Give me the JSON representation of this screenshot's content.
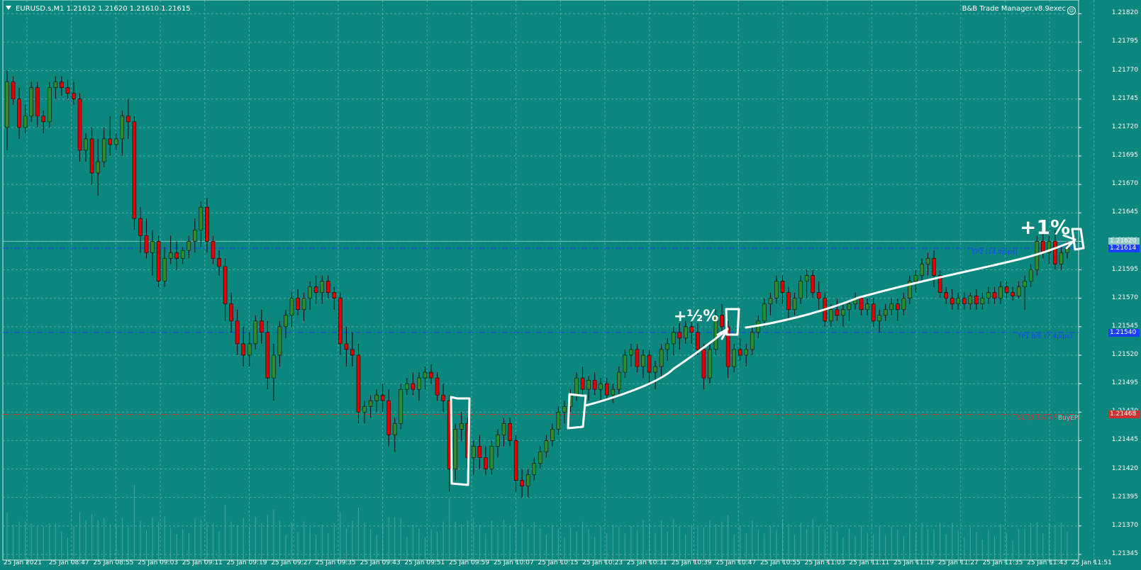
{
  "header": {
    "symbol_info": "EURUSD.s,M1  1.21612 1.21620 1.21610 1.21615",
    "ea_name": "B&B Trade Manager.v8.9exec"
  },
  "price_axis": {
    "labels": [
      "1.21820",
      "1.21795",
      "1.21770",
      "1.21745",
      "1.21720",
      "1.21695",
      "1.21670",
      "1.21645",
      "1.21620",
      "1.21595",
      "1.21570",
      "1.21545",
      "1.21520",
      "1.21495",
      "1.21470",
      "1.21445",
      "1.21420",
      "1.21395",
      "1.21370",
      "1.21345"
    ]
  },
  "price_tags": {
    "bid": "1.21620",
    "tp2": "1.21614",
    "tp1": "1.21540",
    "sl": "1.21468"
  },
  "time_axis": {
    "labels": [
      "25 Jan 2021",
      "25 Jan 08:47",
      "25 Jan 08:55",
      "25 Jan 09:03",
      "25 Jan 09:11",
      "25 Jan 09:19",
      "25 Jan 09:27",
      "25 Jan 09:35",
      "25 Jan 09:43",
      "25 Jan 09:51",
      "25 Jan 09:59",
      "25 Jan 10:07",
      "25 Jan 10:15",
      "25 Jan 10:23",
      "25 Jan 10:31",
      "25 Jan 10:39",
      "25 Jan 10:47",
      "25 Jan 10:55",
      "25 Jan 11:03",
      "25 Jan 11:11",
      "25 Jan 11:19",
      "25 Jan 11:27",
      "25 Jan 11:35",
      "25 Jan 11:43",
      "25 Jan 11:51"
    ]
  },
  "levels": {
    "tp2_label": "TP2 (14.8pips)",
    "tp1_label": "TP1 B/E (7.4pips)",
    "sl_label": "SL (0.3%) (7.4pips)",
    "buy_label": "BuyEP"
  },
  "annotations": {
    "half_percent": "+½%",
    "one_percent": "+1%"
  },
  "colors": {
    "background": "#0c877e",
    "bull_candle": "#2e8b2e",
    "bear_candle": "#e00000",
    "tp_line": "#1a3fff",
    "sl_line": "#d03030",
    "grid": "#8cc9c3",
    "annotation": "#ffffff"
  },
  "chart_data": {
    "type": "candlestick",
    "symbol": "EURUSD.s",
    "timeframe": "M1",
    "ylim": [
      1.2134,
      1.21832
    ],
    "levels": {
      "tp2": 1.21614,
      "tp1": 1.2154,
      "sl": 1.21468,
      "bid": 1.2162
    },
    "ohlc": [
      [
        1.2172,
        1.2177,
        1.217,
        1.2176
      ],
      [
        1.2176,
        1.21765,
        1.2174,
        1.21745
      ],
      [
        1.21745,
        1.21755,
        1.2171,
        1.2172
      ],
      [
        1.2172,
        1.2174,
        1.21715,
        1.2173
      ],
      [
        1.2173,
        1.2176,
        1.21725,
        1.21755
      ],
      [
        1.21755,
        1.2176,
        1.2172,
        1.2173
      ],
      [
        1.2173,
        1.21735,
        1.21715,
        1.21725
      ],
      [
        1.21725,
        1.2176,
        1.2172,
        1.21755
      ],
      [
        1.21755,
        1.21765,
        1.21745,
        1.2176
      ],
      [
        1.2176,
        1.21765,
        1.21748,
        1.21755
      ],
      [
        1.21755,
        1.21762,
        1.21745,
        1.2175
      ],
      [
        1.2175,
        1.2176,
        1.2174,
        1.21745
      ],
      [
        1.21745,
        1.2175,
        1.2169,
        1.217
      ],
      [
        1.217,
        1.21715,
        1.2169,
        1.2171
      ],
      [
        1.2171,
        1.2172,
        1.2167,
        1.2168
      ],
      [
        1.2168,
        1.2171,
        1.2166,
        1.2169
      ],
      [
        1.2169,
        1.2172,
        1.21685,
        1.2171
      ],
      [
        1.2171,
        1.2173,
        1.21695,
        1.21705
      ],
      [
        1.21705,
        1.21715,
        1.217,
        1.2171
      ],
      [
        1.2171,
        1.21735,
        1.21695,
        1.2173
      ],
      [
        1.2173,
        1.21745,
        1.2171,
        1.21725
      ],
      [
        1.21725,
        1.2173,
        1.2163,
        1.2164
      ],
      [
        1.2164,
        1.2165,
        1.2161,
        1.21625
      ],
      [
        1.21625,
        1.2164,
        1.21605,
        1.2161
      ],
      [
        1.2161,
        1.2163,
        1.2159,
        1.2162
      ],
      [
        1.2162,
        1.21625,
        1.2158,
        1.21585
      ],
      [
        1.21585,
        1.21615,
        1.2158,
        1.21605
      ],
      [
        1.21605,
        1.21625,
        1.216,
        1.2161
      ],
      [
        1.2161,
        1.2162,
        1.21595,
        1.21605
      ],
      [
        1.21605,
        1.21615,
        1.216,
        1.21612
      ],
      [
        1.21612,
        1.21625,
        1.21605,
        1.2162
      ],
      [
        1.2162,
        1.2164,
        1.2161,
        1.2163
      ],
      [
        1.2163,
        1.21655,
        1.21615,
        1.2165
      ],
      [
        1.2165,
        1.21658,
        1.2161,
        1.2162
      ],
      [
        1.2162,
        1.21625,
        1.216,
        1.21605
      ],
      [
        1.21605,
        1.21612,
        1.2159,
        1.21598
      ],
      [
        1.21598,
        1.21605,
        1.2155,
        1.21565
      ],
      [
        1.21565,
        1.21575,
        1.2154,
        1.2155
      ],
      [
        1.2155,
        1.2156,
        1.2152,
        1.2153
      ],
      [
        1.2153,
        1.21545,
        1.2151,
        1.2152
      ],
      [
        1.2152,
        1.2154,
        1.2151,
        1.2153
      ],
      [
        1.2153,
        1.21555,
        1.21525,
        1.2155
      ],
      [
        1.2155,
        1.2156,
        1.2153,
        1.2154
      ],
      [
        1.2154,
        1.2155,
        1.2149,
        1.215
      ],
      [
        1.215,
        1.2153,
        1.2148,
        1.2152
      ],
      [
        1.2152,
        1.2155,
        1.2151,
        1.21545
      ],
      [
        1.21545,
        1.2156,
        1.21535,
        1.21555
      ],
      [
        1.21555,
        1.21575,
        1.21545,
        1.2157
      ],
      [
        1.2157,
        1.21578,
        1.21555,
        1.2156
      ],
      [
        1.2156,
        1.21575,
        1.2155,
        1.2157
      ],
      [
        1.2157,
        1.21585,
        1.2156,
        1.2158
      ],
      [
        1.2158,
        1.2159,
        1.21565,
        1.21575
      ],
      [
        1.21575,
        1.2159,
        1.21565,
        1.21585
      ],
      [
        1.21585,
        1.2159,
        1.2157,
        1.21575
      ],
      [
        1.21575,
        1.2158,
        1.2156,
        1.2157
      ],
      [
        1.2157,
        1.21575,
        1.2152,
        1.2153
      ],
      [
        1.2153,
        1.21545,
        1.2151,
        1.21525
      ],
      [
        1.21525,
        1.2154,
        1.2151,
        1.2152
      ],
      [
        1.2152,
        1.2153,
        1.2146,
        1.2147
      ],
      [
        1.2147,
        1.2148,
        1.2146,
        1.21475
      ],
      [
        1.21475,
        1.21485,
        1.21465,
        1.2148
      ],
      [
        1.2148,
        1.2149,
        1.2147,
        1.21485
      ],
      [
        1.21485,
        1.21495,
        1.2147,
        1.2148
      ],
      [
        1.2148,
        1.2149,
        1.2144,
        1.2145
      ],
      [
        1.2145,
        1.21465,
        1.21435,
        1.2146
      ],
      [
        1.2146,
        1.21495,
        1.21455,
        1.2149
      ],
      [
        1.2149,
        1.215,
        1.21485,
        1.21495
      ],
      [
        1.21495,
        1.21505,
        1.21485,
        1.2149
      ],
      [
        1.2149,
        1.21505,
        1.2148,
        1.215
      ],
      [
        1.215,
        1.2151,
        1.2149,
        1.21505
      ],
      [
        1.21505,
        1.21512,
        1.21495,
        1.215
      ],
      [
        1.215,
        1.21505,
        1.2148,
        1.21485
      ],
      [
        1.21485,
        1.21495,
        1.2147,
        1.2148
      ],
      [
        1.2148,
        1.21485,
        1.214,
        1.2142
      ],
      [
        1.2142,
        1.2146,
        1.2141,
        1.21455
      ],
      [
        1.21455,
        1.2147,
        1.21445,
        1.2146
      ],
      [
        1.2146,
        1.21465,
        1.2142,
        1.2143
      ],
      [
        1.2143,
        1.21445,
        1.21415,
        1.2144
      ],
      [
        1.2144,
        1.2145,
        1.2142,
        1.2143
      ],
      [
        1.2143,
        1.2144,
        1.21415,
        1.2142
      ],
      [
        1.2142,
        1.21445,
        1.21415,
        1.2144
      ],
      [
        1.2144,
        1.21455,
        1.2143,
        1.2145
      ],
      [
        1.2145,
        1.21465,
        1.2144,
        1.2146
      ],
      [
        1.2146,
        1.21465,
        1.2144,
        1.21445
      ],
      [
        1.21445,
        1.2145,
        1.214,
        1.2141
      ],
      [
        1.2141,
        1.2142,
        1.21395,
        1.21405
      ],
      [
        1.21405,
        1.2142,
        1.21395,
        1.21415
      ],
      [
        1.21415,
        1.2143,
        1.2141,
        1.21425
      ],
      [
        1.21425,
        1.2144,
        1.2142,
        1.21435
      ],
      [
        1.21435,
        1.2145,
        1.2143,
        1.21445
      ],
      [
        1.21445,
        1.2146,
        1.2144,
        1.21455
      ],
      [
        1.21455,
        1.21475,
        1.2145,
        1.2147
      ],
      [
        1.2147,
        1.2148,
        1.2146,
        1.21475
      ],
      [
        1.21475,
        1.2149,
        1.2147,
        1.21485
      ],
      [
        1.21485,
        1.21505,
        1.2148,
        1.215
      ],
      [
        1.215,
        1.2151,
        1.21485,
        1.2149
      ],
      [
        1.2149,
        1.21502,
        1.2148,
        1.21498
      ],
      [
        1.21498,
        1.21505,
        1.21485,
        1.2149
      ],
      [
        1.2149,
        1.215,
        1.2148,
        1.21495
      ],
      [
        1.21495,
        1.215,
        1.2148,
        1.21485
      ],
      [
        1.21485,
        1.21495,
        1.21478,
        1.2149
      ],
      [
        1.2149,
        1.2151,
        1.21485,
        1.21505
      ],
      [
        1.21505,
        1.21525,
        1.215,
        1.2152
      ],
      [
        1.2152,
        1.2153,
        1.2151,
        1.21525
      ],
      [
        1.21525,
        1.2153,
        1.21505,
        1.2151
      ],
      [
        1.2151,
        1.21525,
        1.215,
        1.2152
      ],
      [
        1.2152,
        1.21525,
        1.21495,
        1.21505
      ],
      [
        1.21505,
        1.21515,
        1.2149,
        1.2151
      ],
      [
        1.2151,
        1.2153,
        1.215,
        1.21525
      ],
      [
        1.21525,
        1.21535,
        1.21515,
        1.2153
      ],
      [
        1.2153,
        1.21545,
        1.2152,
        1.2154
      ],
      [
        1.2154,
        1.21548,
        1.21525,
        1.21535
      ],
      [
        1.21535,
        1.2155,
        1.2153,
        1.21545
      ],
      [
        1.21545,
        1.2155,
        1.2153,
        1.2154
      ],
      [
        1.2154,
        1.21548,
        1.2152,
        1.21525
      ],
      [
        1.21525,
        1.2153,
        1.2149,
        1.215
      ],
      [
        1.215,
        1.2153,
        1.21495,
        1.21525
      ],
      [
        1.21525,
        1.2156,
        1.2152,
        1.21555
      ],
      [
        1.21555,
        1.21565,
        1.2154,
        1.21545
      ],
      [
        1.21545,
        1.2155,
        1.215,
        1.2151
      ],
      [
        1.2151,
        1.2153,
        1.21505,
        1.21525
      ],
      [
        1.21525,
        1.21535,
        1.21515,
        1.2152
      ],
      [
        1.2152,
        1.2153,
        1.2151,
        1.21525
      ],
      [
        1.21525,
        1.21545,
        1.2152,
        1.2154
      ],
      [
        1.2154,
        1.21555,
        1.21535,
        1.2155
      ],
      [
        1.2155,
        1.2157,
        1.21545,
        1.21565
      ],
      [
        1.21565,
        1.21575,
        1.21555,
        1.2157
      ],
      [
        1.2157,
        1.2159,
        1.21565,
        1.21585
      ],
      [
        1.21585,
        1.2159,
        1.21565,
        1.21575
      ],
      [
        1.21575,
        1.2158,
        1.2155,
        1.2156
      ],
      [
        1.2156,
        1.21575,
        1.21555,
        1.2157
      ],
      [
        1.2157,
        1.2159,
        1.21565,
        1.21585
      ],
      [
        1.21585,
        1.21595,
        1.2157,
        1.2159
      ],
      [
        1.2159,
        1.21595,
        1.2157,
        1.21575
      ],
      [
        1.21575,
        1.21585,
        1.2156,
        1.2157
      ],
      [
        1.2157,
        1.21575,
        1.21545,
        1.2155
      ],
      [
        1.2155,
        1.21565,
        1.21545,
        1.2156
      ],
      [
        1.2156,
        1.2157,
        1.2155,
        1.21555
      ],
      [
        1.21555,
        1.21565,
        1.21545,
        1.2156
      ],
      [
        1.2156,
        1.21568,
        1.2155,
        1.21565
      ],
      [
        1.21565,
        1.21575,
        1.2156,
        1.2157
      ],
      [
        1.2157,
        1.21572,
        1.21555,
        1.2156
      ],
      [
        1.2156,
        1.2157,
        1.21555,
        1.21565
      ],
      [
        1.21565,
        1.2157,
        1.21545,
        1.2155
      ],
      [
        1.2155,
        1.2156,
        1.2154,
        1.21555
      ],
      [
        1.21555,
        1.21565,
        1.2155,
        1.2156
      ],
      [
        1.2156,
        1.2157,
        1.21555,
        1.21565
      ],
      [
        1.21565,
        1.2157,
        1.2155,
        1.2156
      ],
      [
        1.2156,
        1.21575,
        1.21555,
        1.2157
      ],
      [
        1.2157,
        1.2159,
        1.21565,
        1.21585
      ],
      [
        1.21585,
        1.21595,
        1.21575,
        1.2159
      ],
      [
        1.2159,
        1.21605,
        1.21585,
        1.216
      ],
      [
        1.216,
        1.2161,
        1.2159,
        1.21605
      ],
      [
        1.21605,
        1.21612,
        1.2158,
        1.2159
      ],
      [
        1.2159,
        1.21595,
        1.2157,
        1.21575
      ],
      [
        1.21575,
        1.2158,
        1.21565,
        1.2157
      ],
      [
        1.2157,
        1.21578,
        1.2156,
        1.21565
      ],
      [
        1.21565,
        1.21575,
        1.2156,
        1.2157
      ],
      [
        1.2157,
        1.21575,
        1.2156,
        1.21565
      ],
      [
        1.21565,
        1.21575,
        1.2156,
        1.21572
      ],
      [
        1.21572,
        1.21578,
        1.2156,
        1.21565
      ],
      [
        1.21565,
        1.21575,
        1.2156,
        1.2157
      ],
      [
        1.2157,
        1.2158,
        1.21565,
        1.21575
      ],
      [
        1.21575,
        1.2158,
        1.21565,
        1.2157
      ],
      [
        1.2157,
        1.21585,
        1.21565,
        1.2158
      ],
      [
        1.2158,
        1.21585,
        1.2157,
        1.21575
      ],
      [
        1.21575,
        1.2158,
        1.21568,
        1.21572
      ],
      [
        1.21572,
        1.21585,
        1.2157,
        1.2158
      ],
      [
        1.2158,
        1.2159,
        1.2156,
        1.21585
      ],
      [
        1.21585,
        1.216,
        1.2158,
        1.21595
      ],
      [
        1.21595,
        1.21625,
        1.2159,
        1.2162
      ],
      [
        1.2162,
        1.2163,
        1.21605,
        1.2161
      ],
      [
        1.2161,
        1.21625,
        1.216,
        1.2162
      ],
      [
        1.2162,
        1.2163,
        1.21595,
        1.216
      ],
      [
        1.216,
        1.21615,
        1.21595,
        1.2161
      ],
      [
        1.2161,
        1.2162,
        1.21605,
        1.21615
      ]
    ]
  }
}
